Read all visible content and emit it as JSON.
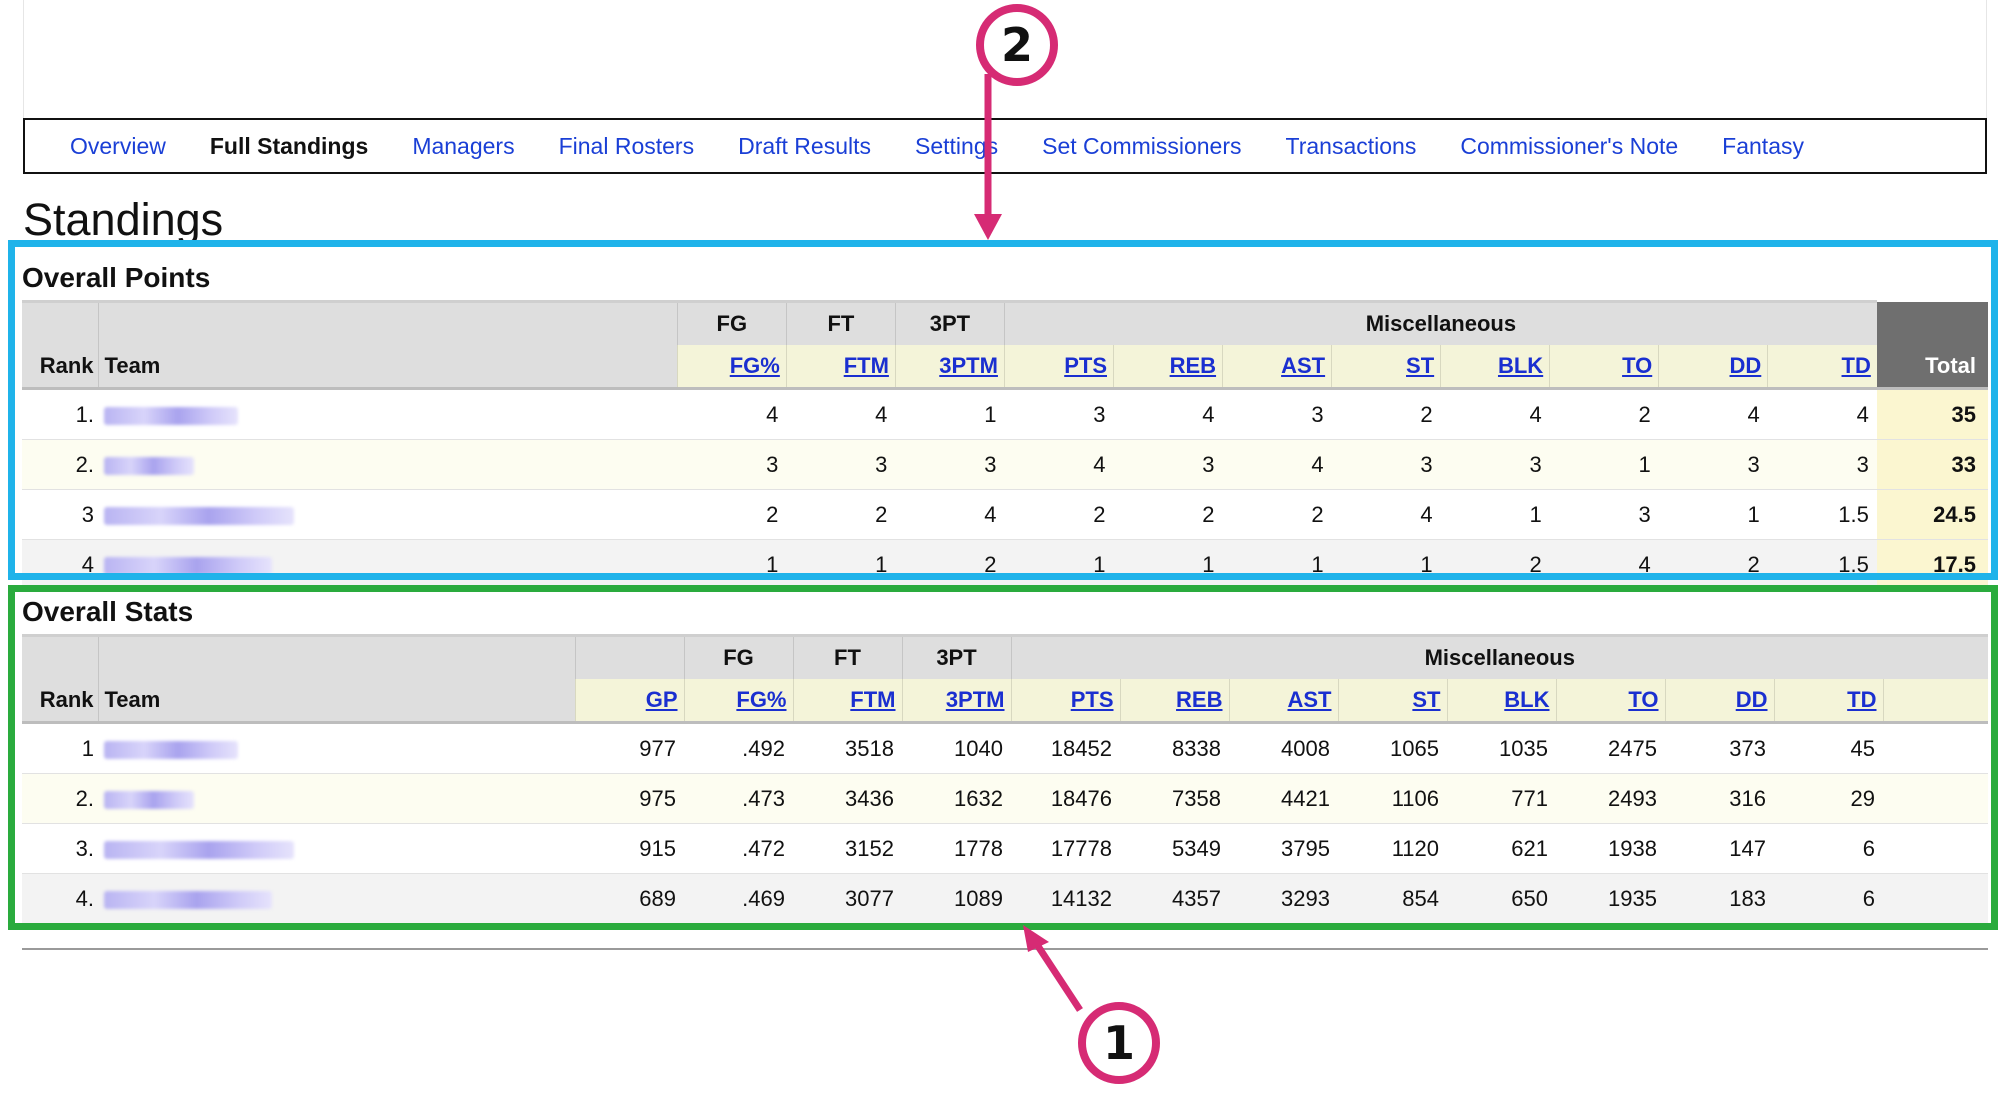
{
  "nav": {
    "tabs": [
      {
        "label": "Overview",
        "active": false
      },
      {
        "label": "Full Standings",
        "active": true
      },
      {
        "label": "Managers",
        "active": false
      },
      {
        "label": "Final Rosters",
        "active": false
      },
      {
        "label": "Draft Results",
        "active": false
      },
      {
        "label": "Settings",
        "active": false
      },
      {
        "label": "Set Commissioners",
        "active": false
      },
      {
        "label": "Transactions",
        "active": false
      },
      {
        "label": "Commissioner's Note",
        "active": false
      },
      {
        "label": "Fantasy",
        "active": false
      }
    ]
  },
  "page_title": "Standings",
  "points": {
    "title": "Overall Points",
    "groups": {
      "fg": "FG",
      "ft": "FT",
      "tpt": "3PT",
      "misc": "Miscellaneous"
    },
    "headers": {
      "rank": "Rank",
      "team": "Team",
      "total": "Total"
    },
    "columns": [
      "FG%",
      "FTM",
      "3PTM",
      "PTS",
      "REB",
      "AST",
      "ST",
      "BLK",
      "TO",
      "DD",
      "TD"
    ],
    "rows": [
      {
        "rank": "1.",
        "values": [
          "4",
          "4",
          "1",
          "3",
          "4",
          "3",
          "2",
          "4",
          "2",
          "4",
          "4"
        ],
        "total": "35"
      },
      {
        "rank": "2.",
        "values": [
          "3",
          "3",
          "3",
          "4",
          "3",
          "4",
          "3",
          "3",
          "1",
          "3",
          "3"
        ],
        "total": "33"
      },
      {
        "rank": "3",
        "values": [
          "2",
          "2",
          "4",
          "2",
          "2",
          "2",
          "4",
          "1",
          "3",
          "1",
          "1.5"
        ],
        "total": "24.5"
      },
      {
        "rank": "4",
        "values": [
          "1",
          "1",
          "2",
          "1",
          "1",
          "1",
          "1",
          "2",
          "4",
          "2",
          "1.5"
        ],
        "total": "17.5"
      }
    ]
  },
  "stats": {
    "title": "Overall Stats",
    "groups": {
      "fg": "FG",
      "ft": "FT",
      "tpt": "3PT",
      "misc": "Miscellaneous"
    },
    "headers": {
      "rank": "Rank",
      "team": "Team"
    },
    "columns": [
      "GP",
      "FG%",
      "FTM",
      "3PTM",
      "PTS",
      "REB",
      "AST",
      "ST",
      "BLK",
      "TO",
      "DD",
      "TD"
    ],
    "rows": [
      {
        "rank": "1",
        "values": [
          "977",
          ".492",
          "3518",
          "1040",
          "18452",
          "8338",
          "4008",
          "1065",
          "1035",
          "2475",
          "373",
          "45"
        ]
      },
      {
        "rank": "2.",
        "values": [
          "975",
          ".473",
          "3436",
          "1632",
          "18476",
          "7358",
          "4421",
          "1106",
          "771",
          "2493",
          "316",
          "29"
        ]
      },
      {
        "rank": "3.",
        "values": [
          "915",
          ".472",
          "3152",
          "1778",
          "17778",
          "5349",
          "3795",
          "1120",
          "621",
          "1938",
          "147",
          "6"
        ]
      },
      {
        "rank": "4.",
        "values": [
          "689",
          ".469",
          "3077",
          "1089",
          "14132",
          "4357",
          "3293",
          "854",
          "650",
          "1935",
          "183",
          "6"
        ]
      }
    ]
  },
  "annotations": {
    "marker_1": "1",
    "marker_2": "2",
    "color": "#d62b74"
  }
}
